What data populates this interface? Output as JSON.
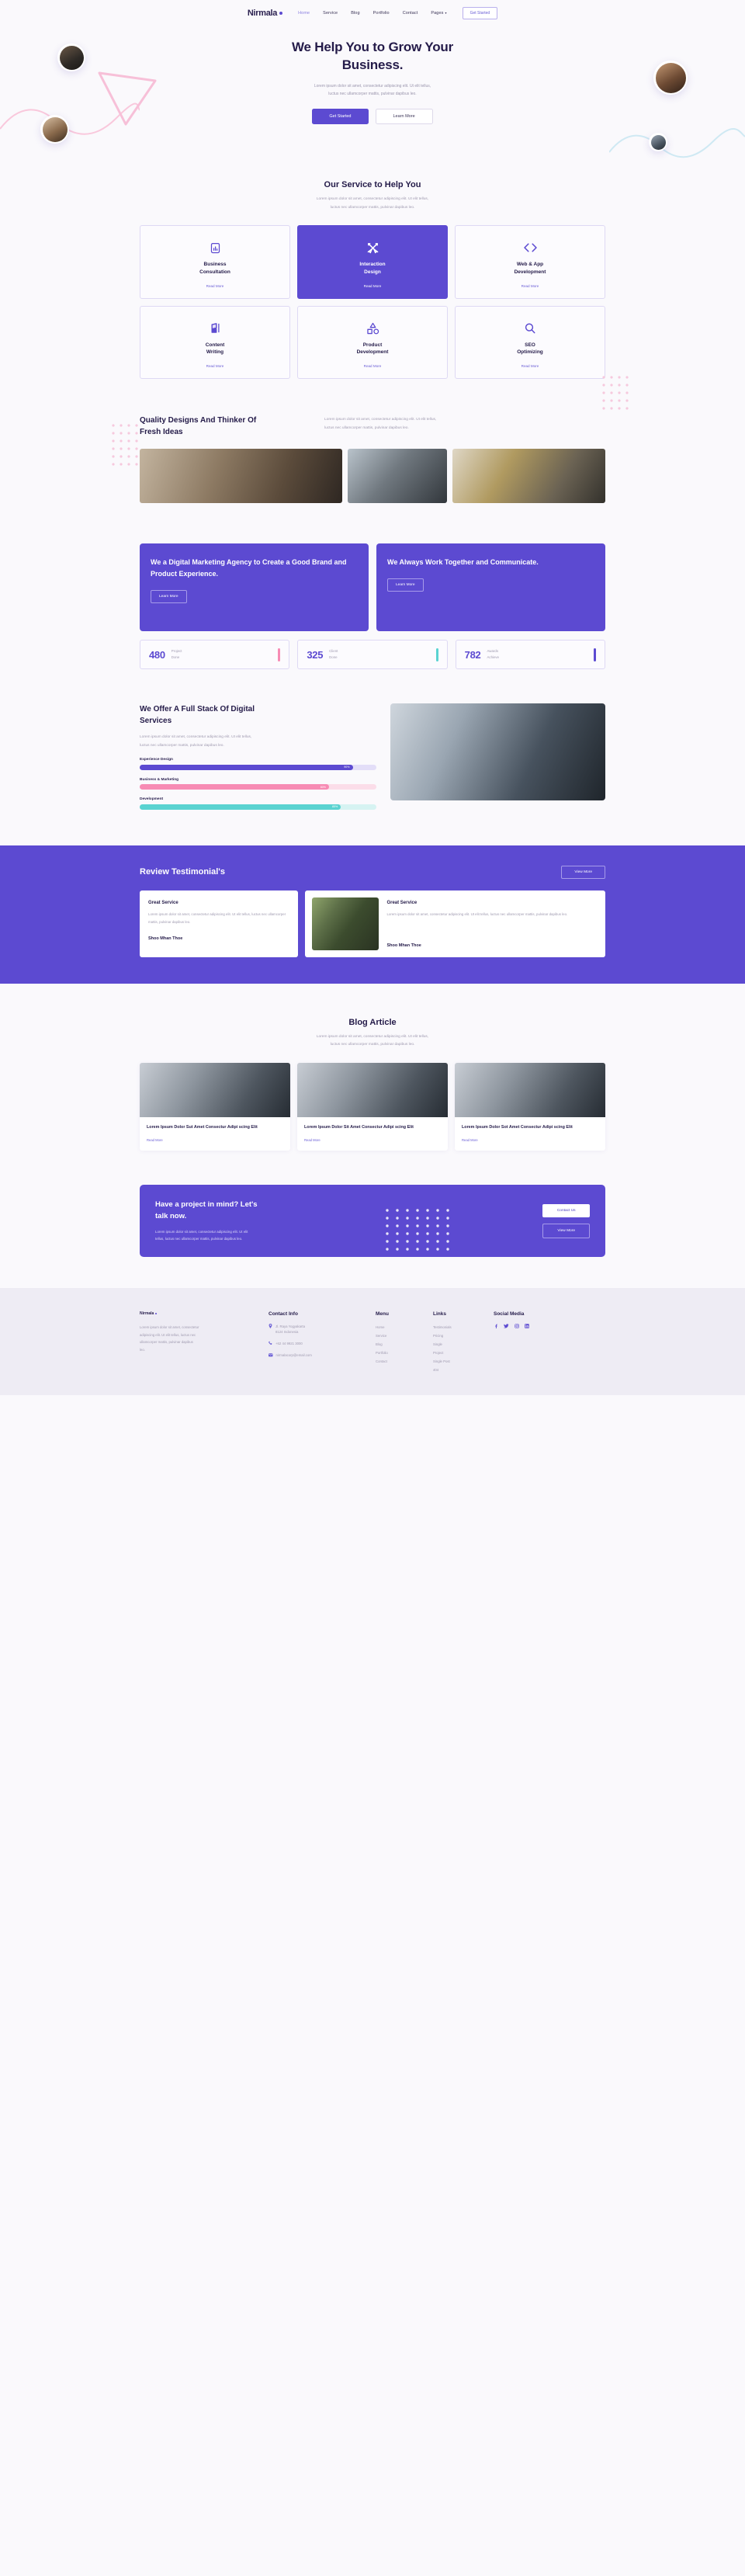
{
  "brand": {
    "name": "Nirmala"
  },
  "nav": {
    "links": [
      {
        "label": "Home",
        "active": true
      },
      {
        "label": "Service",
        "active": false
      },
      {
        "label": "Blog",
        "active": false
      },
      {
        "label": "Portfolio",
        "active": false
      },
      {
        "label": "Contact",
        "active": false
      },
      {
        "label": "Pages",
        "active": false,
        "caret": true
      }
    ],
    "cta": "Get Started"
  },
  "hero": {
    "title_line1": "We Help You to Grow Your",
    "title_line2": "Business.",
    "desc_line1": "Lorem ipsum dolor sit amet, consectetur adipiscing elit. Ut elit tellus,",
    "desc_line2": "luctus nec ullamcorper mattis, pulvinar dapibus leo.",
    "primary_btn": "Get Started",
    "secondary_btn": "Learn More"
  },
  "services": {
    "title": "Our Service to Help You",
    "desc_line1": "Lorem ipsum dolor sit amet, consectetur adipiscing elit. Ut elit tellus,",
    "desc_line2": "luctus nec ullamcorper mattis, pulvinar dapibus leo.",
    "read_more": "Read More",
    "cards": [
      {
        "icon": "chart-bar-icon",
        "title_line1": "Business",
        "title_line2": "Consultation",
        "active": false
      },
      {
        "icon": "design-tools-icon",
        "title_line1": "Interaction",
        "title_line2": "Design",
        "active": true
      },
      {
        "icon": "code-brackets-icon",
        "title_line1": "Web & App",
        "title_line2": "Development",
        "active": false
      },
      {
        "icon": "pen-writing-icon",
        "title_line1": "Content",
        "title_line2": "Writing",
        "active": false
      },
      {
        "icon": "shapes-icon",
        "title_line1": "Product",
        "title_line2": "Development",
        "active": false
      },
      {
        "icon": "magnifier-icon",
        "title_line1": "SEO",
        "title_line2": "Optimizing",
        "active": false
      }
    ]
  },
  "quality": {
    "title_line1": "Quality Designs And Thinker Of",
    "title_line2": "Fresh Ideas",
    "desc_line1": "Lorem ipsum dolor sit amet, consectetur adipiscing elit. Ut elit tellus,",
    "desc_line2": "luctus nec ullamcorper mattis, pulvinar dapibus leo."
  },
  "promo": {
    "cards": [
      {
        "title": "We a Digital Marketing Agency to Create a Good Brand and Product Experience.",
        "btn": "Learn More"
      },
      {
        "title": "We Always Work Together and Communicate.",
        "btn": "Learn More"
      }
    ]
  },
  "stats": [
    {
      "number": "480",
      "label_line1": "Project",
      "label_line2": "Done",
      "color": "#f78bb4"
    },
    {
      "number": "325",
      "label_line1": "Client",
      "label_line2": "Done",
      "color": "#5ad3d1"
    },
    {
      "number": "782",
      "label_line1": "Awards",
      "label_line2": "Achieve",
      "color": "#5c4ad1"
    }
  ],
  "fullstack": {
    "title_line1": "We Offer A Full Stack Of Digital",
    "title_line2": "Services",
    "desc_line1": "Lorem ipsum dolor sit amet, consectetur adipiscing elit. Ut elit tellus,",
    "desc_line2": "luctus nec ullamcorper mattis, pulvinar dapibus leo.",
    "skills": [
      {
        "name": "Experience Design",
        "value": "90%",
        "pct": 90,
        "color": "#5c4ad1",
        "track": "#e3def8"
      },
      {
        "name": "Business & Marketing",
        "value": "80%",
        "pct": 80,
        "color": "#f78bb4",
        "track": "#fbdde9"
      },
      {
        "name": "Development",
        "value": "85%",
        "pct": 85,
        "color": "#5ad3d1",
        "track": "#d6f3f2"
      }
    ]
  },
  "testimonial": {
    "title": "Review Testimonial's",
    "view_more": "View More",
    "cards": [
      {
        "heading": "Great Service",
        "text": "Lorem ipsum dolor sit amet, consectetur adipiscing elit. Ut elit tellus, luctus nec ullamcorper mattis, pulvinar dapibus leo.",
        "author": "Shoo Mhan Thoe"
      },
      {
        "heading": "Great Service",
        "text": "Lorem ipsum dolor sit amet, consectetur adipiscing elit. Ut elit tellus, luctus nec ullamcorper mattis, pulvinar dapibus leo.",
        "author": "Shoo Mhan Thoe"
      }
    ]
  },
  "blog": {
    "title": "Blog Article",
    "desc_line1": "Lorem ipsum dolor sit amet, consectetur adipiscing elit. Ut elit tellus,",
    "desc_line2": "luctus nec ullamcorper mattis, pulvinar dapibus leo.",
    "read_more": "Read More",
    "posts": [
      {
        "title": "Lorem Ipsum Dolor Sut Amet Consectur Adipi scing Elit"
      },
      {
        "title": "Lorem Ipsum Dolor Sit Amet Consectur Adipi scing Elit"
      },
      {
        "title": "Lorem Ipsum Dolor Sot Amet Consectur Adipi scing Elit"
      }
    ]
  },
  "cta": {
    "title_line1": "Have a project in mind? Let's",
    "title_line2": "talk now.",
    "desc_line1": "Lorem ipsum dolor sit amet, consectetur adipiscing elit. Ut elit",
    "desc_line2": "tellus, luctus nec ullamcorper mattis, pulvinar dapibus leo.",
    "primary_btn": "Contact Us",
    "secondary_btn": "View More"
  },
  "footer": {
    "brand": "Nirmala",
    "about_line1": "Lorem ipsum dolor sit amet, consectetur",
    "about_line2": "adipiscing elit. Ut elit tellus, luctus nec",
    "about_line3": "ullamcorper mattis, pulvinar dapibus",
    "about_line4": "leo.",
    "contact": {
      "title": "Contact Info",
      "items": [
        {
          "icon": "location-pin-icon",
          "line1": "Jl. Raya Yogyakarta",
          "line2": "8124 Indonesia"
        },
        {
          "icon": "phone-icon",
          "line1": "+62 44 9921 3000",
          "line2": ""
        },
        {
          "icon": "mail-icon",
          "line1": "nirmalacorp@email.com",
          "line2": ""
        }
      ]
    },
    "menu": {
      "title": "Menu",
      "items": [
        "Home",
        "Service",
        "Blog",
        "Portfolio",
        "Contact"
      ]
    },
    "links": {
      "title": "Links",
      "items": [
        "Testimonials",
        "Pricing",
        "Single",
        "Project",
        "Single Post",
        "404"
      ]
    },
    "social": {
      "title": "Social Media",
      "items": [
        "facebook-icon",
        "twitter-icon",
        "instagram-icon",
        "linkedin-icon"
      ],
      "glyphs": [
        "f",
        "t",
        "◎",
        "in"
      ]
    }
  },
  "colors": {
    "primary": "#5c4ad1",
    "dark": "#241b49",
    "muted": "#a09bb0",
    "pink": "#f78bb4",
    "teal": "#5ad3d1"
  }
}
